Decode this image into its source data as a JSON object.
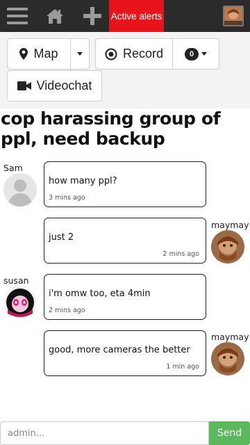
{
  "nav": {
    "menu_icon": "hamburger-menu-icon",
    "home_icon": "home-icon",
    "add_icon": "plus-icon",
    "alerts_label": "Active alerts",
    "alerts_color": "#e8141b",
    "profile": "profile-avatar"
  },
  "toolbar": {
    "map_label": "Map",
    "map_icon": "map-marker-icon",
    "record_label": "Record",
    "record_icon": "record-icon",
    "count_badge": "0",
    "videochat_label": "Videochat",
    "videochat_icon": "video-camera-icon"
  },
  "alert": {
    "title": "cop harassing group of ppl, need backup"
  },
  "messages": [
    {
      "user": "Sam",
      "side": "left",
      "text": "how many ppl?",
      "time": "3 mins ago"
    },
    {
      "user": "maymay",
      "side": "right",
      "text": "just 2",
      "time": "2 mins ago"
    },
    {
      "user": "susan",
      "side": "left",
      "text": "i'm omw too, eta 4min",
      "time": "2 mins ago"
    },
    {
      "user": "maymay",
      "side": "right",
      "text": "good, more cameras the better",
      "time": "1 min ago"
    }
  ],
  "composer": {
    "placeholder": "admin...",
    "send_label": "Send",
    "send_color": "#5cb85c"
  }
}
